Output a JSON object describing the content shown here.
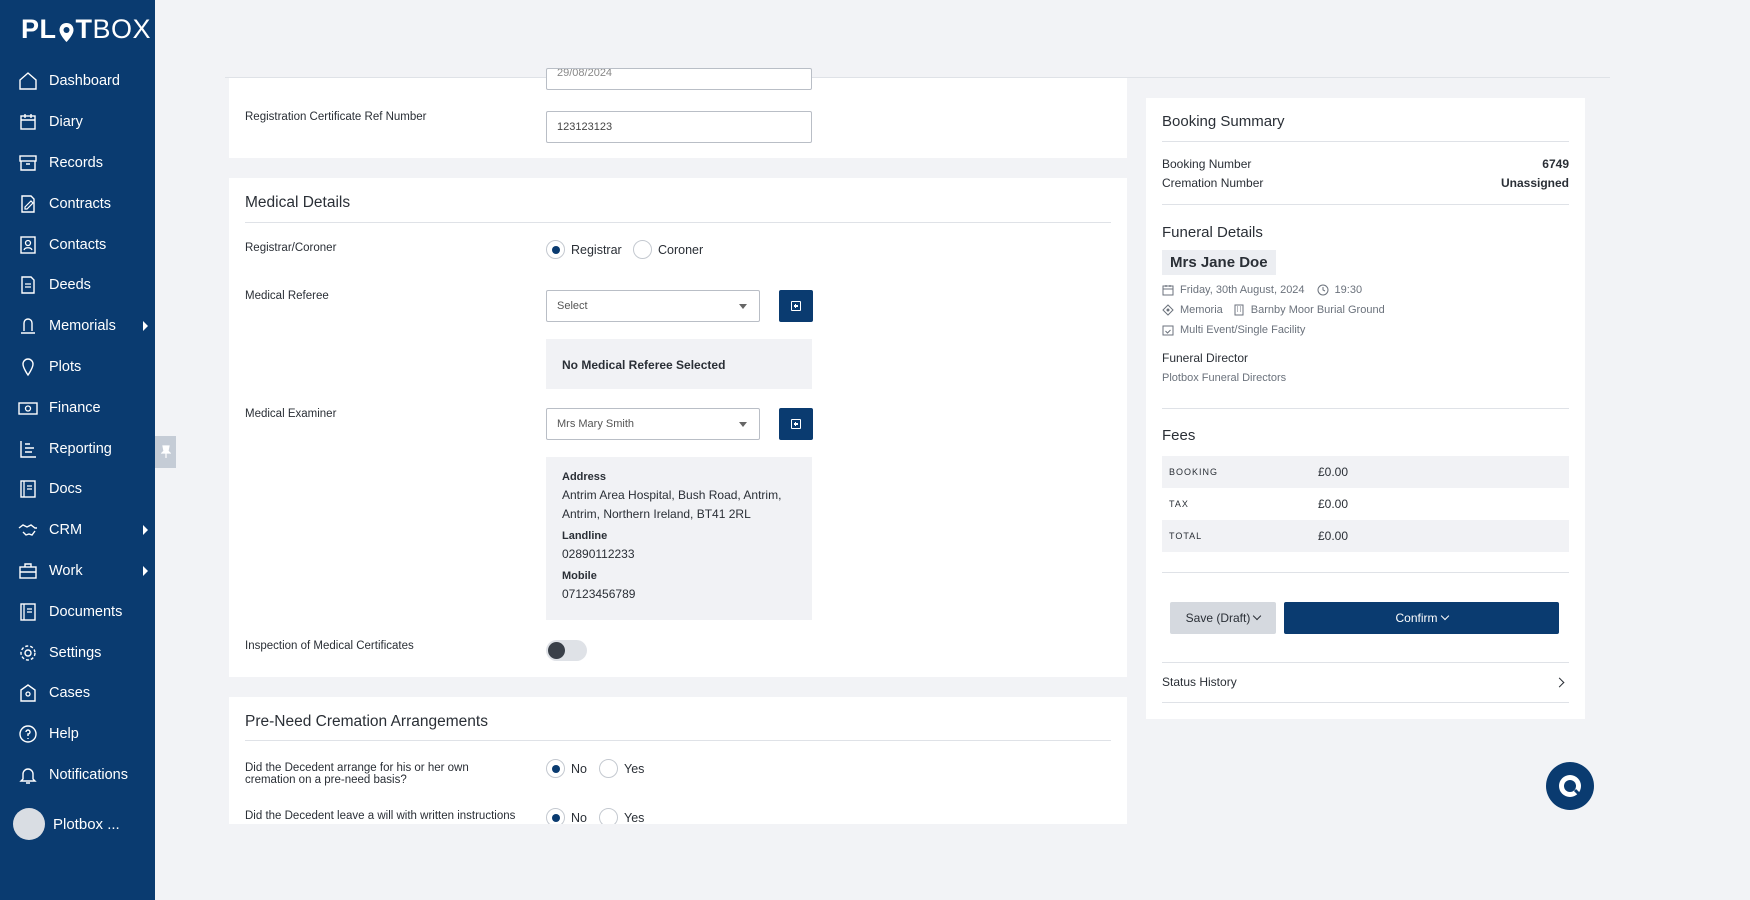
{
  "app": {
    "logo_a": "PL",
    "logo_b": "T",
    "logo_c": "BOX"
  },
  "sidebar": {
    "items": [
      {
        "label": "Dashboard",
        "icon": "home-icon"
      },
      {
        "label": "Diary",
        "icon": "calendar-icon"
      },
      {
        "label": "Records",
        "icon": "archive-icon"
      },
      {
        "label": "Contracts",
        "icon": "contract-icon"
      },
      {
        "label": "Contacts",
        "icon": "contact-card-icon"
      },
      {
        "label": "Deeds",
        "icon": "document-icon"
      },
      {
        "label": "Memorials",
        "icon": "memorial-icon",
        "submenu": true
      },
      {
        "label": "Plots",
        "icon": "map-pin-icon"
      },
      {
        "label": "Finance",
        "icon": "money-icon"
      },
      {
        "label": "Reporting",
        "icon": "chart-icon"
      },
      {
        "label": "Docs",
        "icon": "book-icon"
      },
      {
        "label": "CRM",
        "icon": "handshake-icon",
        "submenu": true
      },
      {
        "label": "Work",
        "icon": "briefcase-icon",
        "submenu": true
      },
      {
        "label": "Documents",
        "icon": "book-icon"
      },
      {
        "label": "Settings",
        "icon": "gear-icon"
      },
      {
        "label": "Cases",
        "icon": "case-icon"
      },
      {
        "label": "Help",
        "icon": "help-circle-icon"
      },
      {
        "label": "Notifications",
        "icon": "bell-icon"
      }
    ],
    "user_name": "Plotbox ..."
  },
  "registration": {
    "date_value": "29/08/2024",
    "cert_ref_label": "Registration Certificate Ref Number",
    "cert_ref_value": "123123123"
  },
  "medical": {
    "title": "Medical Details",
    "registrar_label": "Registrar/Coroner",
    "opt_registrar": "Registrar",
    "opt_coroner": "Coroner",
    "selected": "Registrar",
    "referee_label": "Medical Referee",
    "referee_placeholder": "Select",
    "referee_empty": "No Medical Referee Selected",
    "examiner_label": "Medical Examiner",
    "examiner_value": "Mrs Mary Smith",
    "address_label": "Address",
    "address_line1": "Antrim Area Hospital, Bush Road, Antrim,",
    "address_line2": "Antrim, Northern Ireland, BT41 2RL",
    "landline_label": "Landline",
    "landline_value": "02890112233",
    "mobile_label": "Mobile",
    "mobile_value": "07123456789",
    "inspection_label": "Inspection of Medical Certificates",
    "inspection_on": false
  },
  "preneed": {
    "title": "Pre-Need Cremation Arrangements",
    "q1_line1": "Did the Decedent arrange for his or her own",
    "q1_line2": "cremation on a pre-need basis?",
    "q2": "Did the Decedent leave a will with written instructions",
    "no": "No",
    "yes": "Yes",
    "q1_answer": "No",
    "q2_answer": "No"
  },
  "summary": {
    "title": "Booking Summary",
    "booking_number_label": "Booking Number",
    "booking_number": "6749",
    "cremation_number_label": "Cremation Number",
    "cremation_number": "Unassigned",
    "funeral_title": "Funeral Details",
    "deceased": "Mrs Jane Doe",
    "date": "Friday, 30th August, 2024",
    "time": "19:30",
    "site": "Memoria",
    "location": "Barnby Moor Burial Ground",
    "event_type": "Multi Event/Single Facility",
    "director_label": "Funeral Director",
    "director": "Plotbox Funeral Directors",
    "fees_title": "Fees",
    "fees": [
      {
        "label": "BOOKING",
        "value": "£0.00"
      },
      {
        "label": "TAX",
        "value": "£0.00"
      },
      {
        "label": "TOTAL",
        "value": "£0.00"
      }
    ],
    "draft_label": "Save (Draft)",
    "confirm_label": "Confirm",
    "status_history": "Status History"
  },
  "colors": {
    "brand": "#0a3b70",
    "background": "#f2f3f6"
  }
}
